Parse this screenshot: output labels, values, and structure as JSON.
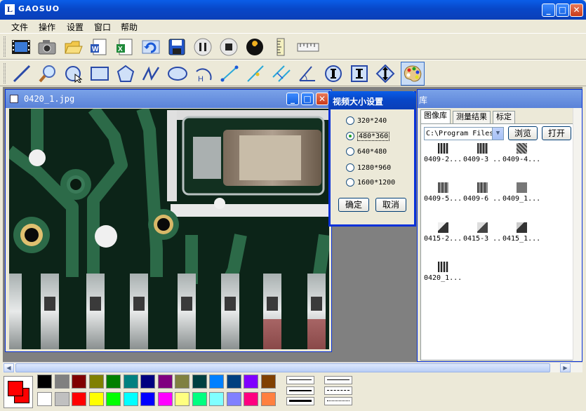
{
  "window": {
    "title": "GAOSUO",
    "icon_letter": "L",
    "minimize": "_",
    "maximize": "□",
    "close": "✕"
  },
  "menu": [
    {
      "label": "文件"
    },
    {
      "label": "操作"
    },
    {
      "label": "设置"
    },
    {
      "label": "窗口"
    },
    {
      "label": "帮助"
    }
  ],
  "toolbar1": [
    {
      "name": "video-icon"
    },
    {
      "name": "camera-icon"
    },
    {
      "name": "open-folder-icon"
    },
    {
      "name": "word-export-icon"
    },
    {
      "name": "excel-export-icon"
    },
    {
      "name": "refresh-icon"
    },
    {
      "name": "save-icon"
    },
    {
      "name": "pause-icon"
    },
    {
      "name": "stop-icon"
    },
    {
      "name": "wrench-icon"
    },
    {
      "name": "vertical-ruler-icon"
    },
    {
      "name": "horizontal-ruler-icon"
    }
  ],
  "toolbar2": [
    {
      "name": "line-tool-icon"
    },
    {
      "name": "zoom-icon"
    },
    {
      "name": "circle-cursor-icon"
    },
    {
      "name": "rectangle-tool-icon"
    },
    {
      "name": "polygon-tool-icon"
    },
    {
      "name": "polyline-tool-icon"
    },
    {
      "name": "ellipse-tool-icon"
    },
    {
      "name": "arc-tool-icon"
    },
    {
      "name": "distance-tool-icon"
    },
    {
      "name": "point-line-tool-icon"
    },
    {
      "name": "parallel-line-tool-icon"
    },
    {
      "name": "angle-tool-icon"
    },
    {
      "name": "circle-measure-icon"
    },
    {
      "name": "text-tool-icon"
    },
    {
      "name": "vertical-measure-icon"
    },
    {
      "name": "palette-icon"
    }
  ],
  "image_window": {
    "title": "0420_1.jpg",
    "minimize": "_",
    "maximize": "□",
    "close": "✕"
  },
  "library": {
    "title": "库",
    "tabs": [
      {
        "label": "图像库"
      },
      {
        "label": "测量结果"
      },
      {
        "label": "标定"
      }
    ],
    "path": "C:\\Program Files",
    "dropdown_arrow": "▼",
    "browse_label": "浏览",
    "open_label": "打开",
    "thumbnails": [
      {
        "label": "0409-2..."
      },
      {
        "label": "0409-3 .."
      },
      {
        "label": "0409-4..."
      },
      {
        "label": "0409-5..."
      },
      {
        "label": "0409-6 .."
      },
      {
        "label": "0409_1..."
      },
      {
        "label": "0415-2..."
      },
      {
        "label": "0415-3 .."
      },
      {
        "label": "0415_1..."
      },
      {
        "label": "0420_1..."
      }
    ]
  },
  "dialog": {
    "title": "视频大小设置",
    "options": [
      {
        "label": "320*240",
        "selected": false
      },
      {
        "label": "480*360",
        "selected": true
      },
      {
        "label": "640*480",
        "selected": false
      },
      {
        "label": "1280*960",
        "selected": false
      },
      {
        "label": "1600*1200",
        "selected": false
      }
    ],
    "ok_label": "确定",
    "cancel_label": "取消"
  },
  "palette": {
    "foreground": "#ff0000",
    "background": "#ff0000",
    "row1": [
      "#000000",
      "#808080",
      "#800000",
      "#808000",
      "#008000",
      "#008080",
      "#000080",
      "#800080",
      "#808040",
      "#004040",
      "#0080ff",
      "#004080",
      "#8000ff",
      "#804000"
    ],
    "row2": [
      "#ffffff",
      "#c0c0c0",
      "#ff0000",
      "#ffff00",
      "#00ff00",
      "#00ffff",
      "#0000ff",
      "#ff00ff",
      "#ffff80",
      "#00ff80",
      "#80ffff",
      "#8080ff",
      "#ff0080",
      "#ff8040"
    ]
  }
}
